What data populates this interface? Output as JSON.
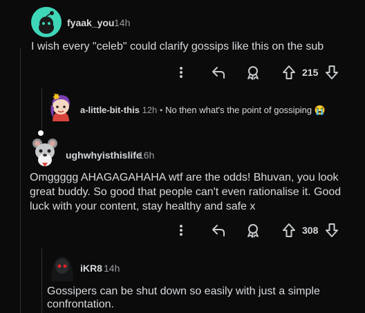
{
  "comments": [
    {
      "username": "fyaak_you",
      "time": "14h",
      "body": "I wish every \"celeb\" could clarify gossips like this on the sub",
      "votes": "215"
    },
    {
      "username": "a-little-bit-this",
      "time": "12h",
      "separator": "•",
      "body": "No then what's the point of gossiping",
      "emoji": "😭"
    },
    {
      "username": "ughwhyisthislife",
      "time": "16h",
      "body_lines": [
        "Omggggg AHAGAGAHAHA wtf are the odds! Bhuvan, you look",
        "great buddy. So good that people can't even rationalise it. Good",
        "luck with your content, stay healthy and safe x"
      ],
      "votes": "308"
    },
    {
      "username": "iKR8",
      "time": "14h",
      "body_lines": [
        "Gossipers can be shut down so easily with just a simple",
        "confrontation."
      ]
    }
  ],
  "colors": {
    "background": "#0b0b0c",
    "teal_avatar": "#3fd6b8",
    "thread_line": "#343536"
  },
  "icons": [
    "more-vert-icon",
    "reply-icon",
    "award-icon",
    "upvote-icon",
    "downvote-icon"
  ]
}
